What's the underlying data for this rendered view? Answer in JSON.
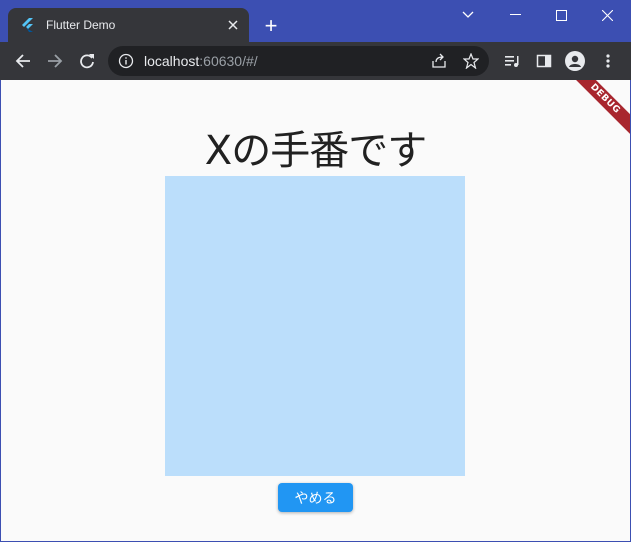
{
  "browser": {
    "tab_title": "Flutter Demo",
    "new_tab_label": "+",
    "url_host": "localhost",
    "url_rest": ":60630/#/"
  },
  "page": {
    "heading": "Xの手番です",
    "quit_button_label": "やめる",
    "debug_banner": "DEBUG"
  },
  "colors": {
    "board": "#bbdefb",
    "button": "#2196f3",
    "frame": "#3c4fb2"
  }
}
